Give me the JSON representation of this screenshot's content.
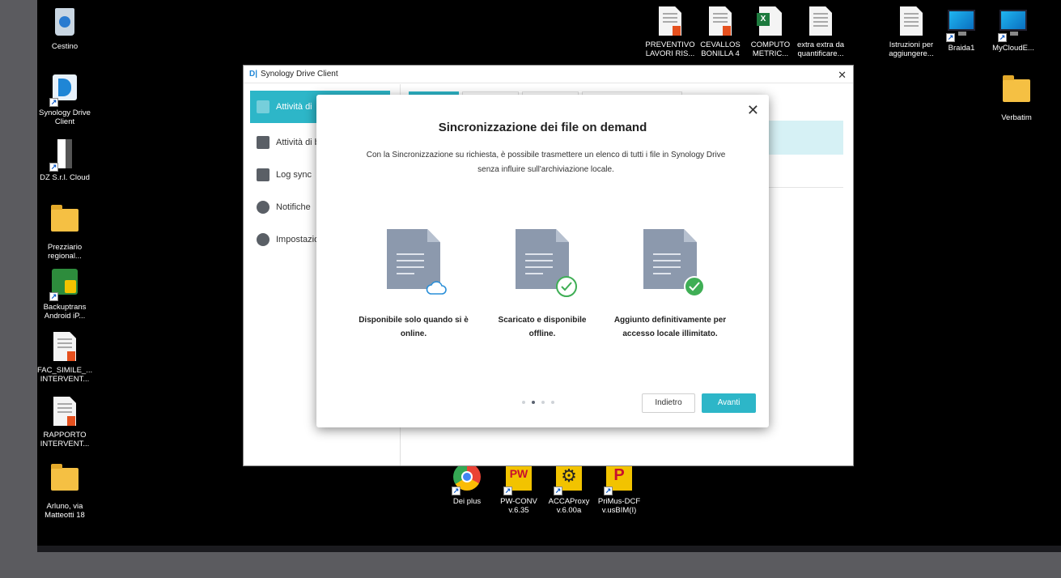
{
  "desktop": {
    "left_icons": [
      {
        "label": "Cestino",
        "icon": "recycle-bin-icon"
      },
      {
        "label": "Synology Drive Client",
        "icon": "synology-drive-icon"
      },
      {
        "label": "DZ S.r.l. Cloud",
        "icon": "nas-device-icon"
      },
      {
        "label": "Prezziario regional...",
        "icon": "folder-icon"
      },
      {
        "label": "Backuptrans Android iP...",
        "icon": "backuptrans-icon"
      },
      {
        "label": "FAC_SIMILE_... INTERVENT...",
        "icon": "pdf-document-icon"
      },
      {
        "label": "RAPPORTO INTERVENT...",
        "icon": "pdf-document-icon"
      },
      {
        "label": "Arluno, via Matteotti 18",
        "icon": "folder-icon"
      }
    ],
    "top_icons": [
      {
        "label": "PREVENTIVO LAVORI RIS...",
        "icon": "pdf-document-icon"
      },
      {
        "label": "CEVALLOS BONILLA 4",
        "icon": "pdf-document-icon"
      },
      {
        "label": "COMPUTO METRIC...",
        "icon": "excel-document-icon"
      },
      {
        "label": "extra extra da quantificare...",
        "icon": "text-document-icon"
      },
      {
        "label": "Istruzioni per aggiungere...",
        "icon": "text-document-icon"
      },
      {
        "label": "Braida1",
        "icon": "monitor-shortcut-icon"
      },
      {
        "label": "MyCloudE...",
        "icon": "monitor-shortcut-icon"
      }
    ],
    "right_icons": [
      {
        "label": "Verbatim",
        "icon": "folder-icon"
      }
    ],
    "bottom_icons": [
      {
        "label": "Dei plus",
        "icon": "chrome-icon"
      },
      {
        "label": "PW-CONV v.6.35",
        "icon": "pw-conv-icon"
      },
      {
        "label": "ACCAProxy v.6.00a",
        "icon": "gear-icon"
      },
      {
        "label": "PriMus-DCF v.usBIM(I)",
        "icon": "primus-icon"
      }
    ]
  },
  "window": {
    "logo": "D|",
    "title": "Synology Drive Client",
    "close": "✕",
    "sidebar": [
      {
        "label": "Attività di"
      },
      {
        "label": "Attività di b"
      },
      {
        "label": "Log sync"
      },
      {
        "label": "Notifiche"
      },
      {
        "label": "Impostazio"
      }
    ]
  },
  "dialog": {
    "title": "Sincronizzazione dei file on demand",
    "description": "Con la Sincronizzazione su richiesta, è possibile trasmettere un elenco di tutti i file in Synology Drive senza influire sull'archiviazione locale.",
    "close": "✕",
    "features": [
      {
        "label": "Disponibile solo quando si è online.",
        "badge": "cloud-icon"
      },
      {
        "label": "Scaricato e disponibile offline.",
        "badge": "check-outline-icon"
      },
      {
        "label": "Aggiunto definitivamente per accesso locale illimitato.",
        "badge": "check-solid-icon"
      }
    ],
    "pagination": {
      "current": 2,
      "total": 4
    },
    "back_label": "Indietro",
    "next_label": "Avanti"
  },
  "colors": {
    "accent": "#2db6c8",
    "check_green": "#3fae55",
    "doc_grey": "#8c99ad"
  }
}
